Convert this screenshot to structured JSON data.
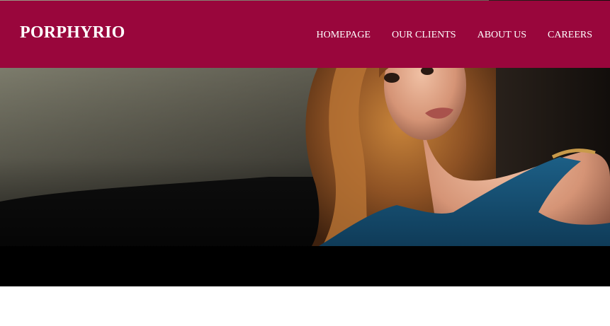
{
  "site": {
    "logo": "PORPHYRIO",
    "brand_color": "#99063c"
  },
  "nav": {
    "items": [
      {
        "label": "HOMEPAGE"
      },
      {
        "label": "OUR CLIENTS"
      },
      {
        "label": "ABOUT US"
      },
      {
        "label": "CAREERS"
      }
    ]
  },
  "hero": {
    "image": "portrait-photo"
  }
}
